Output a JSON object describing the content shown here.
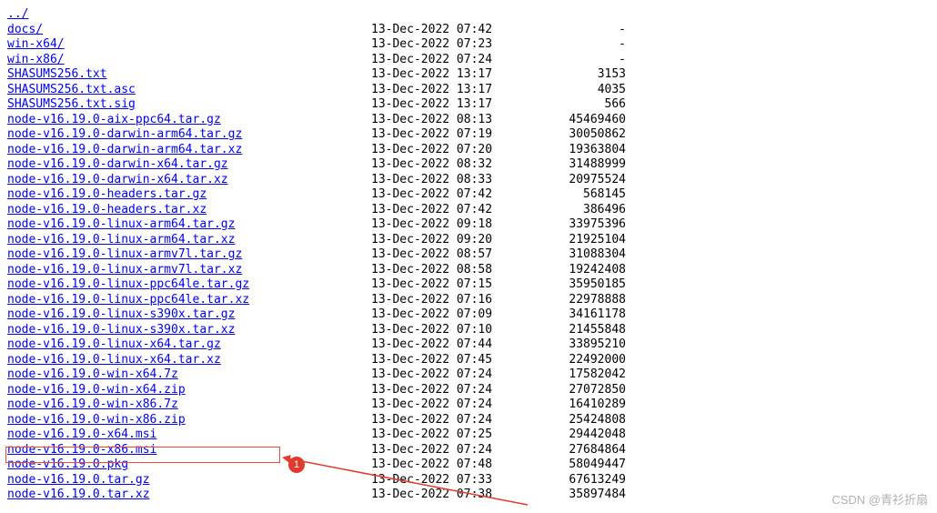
{
  "parent_link": "../",
  "files": [
    {
      "name": "docs/",
      "date": "13-Dec-2022 07:42",
      "size": "-"
    },
    {
      "name": "win-x64/",
      "date": "13-Dec-2022 07:23",
      "size": "-"
    },
    {
      "name": "win-x86/",
      "date": "13-Dec-2022 07:24",
      "size": "-"
    },
    {
      "name": "SHASUMS256.txt",
      "date": "13-Dec-2022 13:17",
      "size": "3153"
    },
    {
      "name": "SHASUMS256.txt.asc",
      "date": "13-Dec-2022 13:17",
      "size": "4035"
    },
    {
      "name": "SHASUMS256.txt.sig",
      "date": "13-Dec-2022 13:17",
      "size": "566"
    },
    {
      "name": "node-v16.19.0-aix-ppc64.tar.gz",
      "date": "13-Dec-2022 08:13",
      "size": "45469460"
    },
    {
      "name": "node-v16.19.0-darwin-arm64.tar.gz",
      "date": "13-Dec-2022 07:19",
      "size": "30050862"
    },
    {
      "name": "node-v16.19.0-darwin-arm64.tar.xz",
      "date": "13-Dec-2022 07:20",
      "size": "19363804"
    },
    {
      "name": "node-v16.19.0-darwin-x64.tar.gz",
      "date": "13-Dec-2022 08:32",
      "size": "31488999"
    },
    {
      "name": "node-v16.19.0-darwin-x64.tar.xz",
      "date": "13-Dec-2022 08:33",
      "size": "20975524"
    },
    {
      "name": "node-v16.19.0-headers.tar.gz",
      "date": "13-Dec-2022 07:42",
      "size": "568145"
    },
    {
      "name": "node-v16.19.0-headers.tar.xz",
      "date": "13-Dec-2022 07:42",
      "size": "386496"
    },
    {
      "name": "node-v16.19.0-linux-arm64.tar.gz",
      "date": "13-Dec-2022 09:18",
      "size": "33975396"
    },
    {
      "name": "node-v16.19.0-linux-arm64.tar.xz",
      "date": "13-Dec-2022 09:20",
      "size": "21925104"
    },
    {
      "name": "node-v16.19.0-linux-armv7l.tar.gz",
      "date": "13-Dec-2022 08:57",
      "size": "31088304"
    },
    {
      "name": "node-v16.19.0-linux-armv7l.tar.xz",
      "date": "13-Dec-2022 08:58",
      "size": "19242408"
    },
    {
      "name": "node-v16.19.0-linux-ppc64le.tar.gz",
      "date": "13-Dec-2022 07:15",
      "size": "35950185"
    },
    {
      "name": "node-v16.19.0-linux-ppc64le.tar.xz",
      "date": "13-Dec-2022 07:16",
      "size": "22978888"
    },
    {
      "name": "node-v16.19.0-linux-s390x.tar.gz",
      "date": "13-Dec-2022 07:09",
      "size": "34161178"
    },
    {
      "name": "node-v16.19.0-linux-s390x.tar.xz",
      "date": "13-Dec-2022 07:10",
      "size": "21455848"
    },
    {
      "name": "node-v16.19.0-linux-x64.tar.gz",
      "date": "13-Dec-2022 07:44",
      "size": "33895210"
    },
    {
      "name": "node-v16.19.0-linux-x64.tar.xz",
      "date": "13-Dec-2022 07:45",
      "size": "22492000"
    },
    {
      "name": "node-v16.19.0-win-x64.7z",
      "date": "13-Dec-2022 07:24",
      "size": "17582042"
    },
    {
      "name": "node-v16.19.0-win-x64.zip",
      "date": "13-Dec-2022 07:24",
      "size": "27072850"
    },
    {
      "name": "node-v16.19.0-win-x86.7z",
      "date": "13-Dec-2022 07:24",
      "size": "16410289"
    },
    {
      "name": "node-v16.19.0-win-x86.zip",
      "date": "13-Dec-2022 07:24",
      "size": "25424808"
    },
    {
      "name": "node-v16.19.0-x64.msi",
      "date": "13-Dec-2022 07:25",
      "size": "29442048"
    },
    {
      "name": "node-v16.19.0-x86.msi",
      "date": "13-Dec-2022 07:24",
      "size": "27684864"
    },
    {
      "name": "node-v16.19.0.pkg",
      "date": "13-Dec-2022 07:48",
      "size": "58049447"
    },
    {
      "name": "node-v16.19.0.tar.gz",
      "date": "13-Dec-2022 07:33",
      "size": "67613249"
    },
    {
      "name": "node-v16.19.0.tar.xz",
      "date": "13-Dec-2022 07:38",
      "size": "35897484"
    }
  ],
  "annotation_badge": "1",
  "watermark": "CSDN @青衫折扇"
}
